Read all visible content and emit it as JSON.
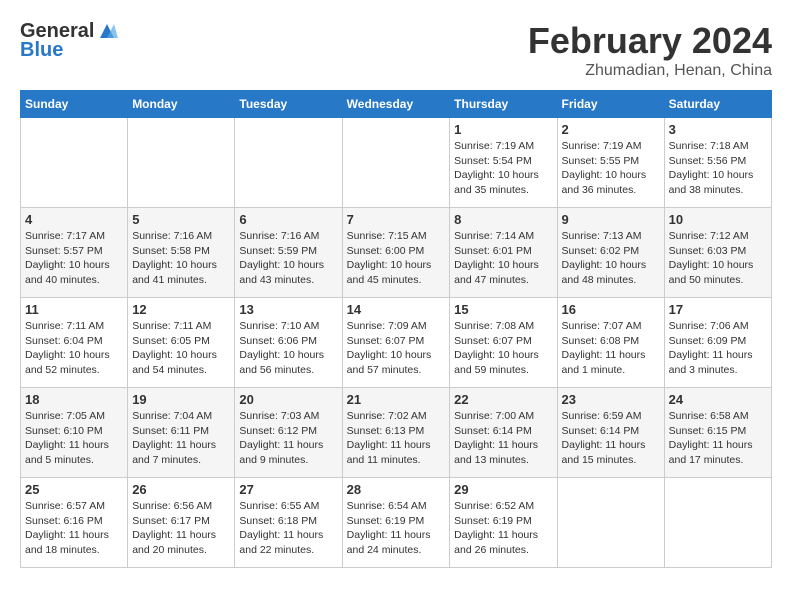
{
  "header": {
    "logo_general": "General",
    "logo_blue": "Blue",
    "month_title": "February 2024",
    "location": "Zhumadian, Henan, China"
  },
  "columns": [
    "Sunday",
    "Monday",
    "Tuesday",
    "Wednesday",
    "Thursday",
    "Friday",
    "Saturday"
  ],
  "weeks": [
    [
      {
        "day": "",
        "info": ""
      },
      {
        "day": "",
        "info": ""
      },
      {
        "day": "",
        "info": ""
      },
      {
        "day": "",
        "info": ""
      },
      {
        "day": "1",
        "info": "Sunrise: 7:19 AM\nSunset: 5:54 PM\nDaylight: 10 hours\nand 35 minutes."
      },
      {
        "day": "2",
        "info": "Sunrise: 7:19 AM\nSunset: 5:55 PM\nDaylight: 10 hours\nand 36 minutes."
      },
      {
        "day": "3",
        "info": "Sunrise: 7:18 AM\nSunset: 5:56 PM\nDaylight: 10 hours\nand 38 minutes."
      }
    ],
    [
      {
        "day": "4",
        "info": "Sunrise: 7:17 AM\nSunset: 5:57 PM\nDaylight: 10 hours\nand 40 minutes."
      },
      {
        "day": "5",
        "info": "Sunrise: 7:16 AM\nSunset: 5:58 PM\nDaylight: 10 hours\nand 41 minutes."
      },
      {
        "day": "6",
        "info": "Sunrise: 7:16 AM\nSunset: 5:59 PM\nDaylight: 10 hours\nand 43 minutes."
      },
      {
        "day": "7",
        "info": "Sunrise: 7:15 AM\nSunset: 6:00 PM\nDaylight: 10 hours\nand 45 minutes."
      },
      {
        "day": "8",
        "info": "Sunrise: 7:14 AM\nSunset: 6:01 PM\nDaylight: 10 hours\nand 47 minutes."
      },
      {
        "day": "9",
        "info": "Sunrise: 7:13 AM\nSunset: 6:02 PM\nDaylight: 10 hours\nand 48 minutes."
      },
      {
        "day": "10",
        "info": "Sunrise: 7:12 AM\nSunset: 6:03 PM\nDaylight: 10 hours\nand 50 minutes."
      }
    ],
    [
      {
        "day": "11",
        "info": "Sunrise: 7:11 AM\nSunset: 6:04 PM\nDaylight: 10 hours\nand 52 minutes."
      },
      {
        "day": "12",
        "info": "Sunrise: 7:11 AM\nSunset: 6:05 PM\nDaylight: 10 hours\nand 54 minutes."
      },
      {
        "day": "13",
        "info": "Sunrise: 7:10 AM\nSunset: 6:06 PM\nDaylight: 10 hours\nand 56 minutes."
      },
      {
        "day": "14",
        "info": "Sunrise: 7:09 AM\nSunset: 6:07 PM\nDaylight: 10 hours\nand 57 minutes."
      },
      {
        "day": "15",
        "info": "Sunrise: 7:08 AM\nSunset: 6:07 PM\nDaylight: 10 hours\nand 59 minutes."
      },
      {
        "day": "16",
        "info": "Sunrise: 7:07 AM\nSunset: 6:08 PM\nDaylight: 11 hours\nand 1 minute."
      },
      {
        "day": "17",
        "info": "Sunrise: 7:06 AM\nSunset: 6:09 PM\nDaylight: 11 hours\nand 3 minutes."
      }
    ],
    [
      {
        "day": "18",
        "info": "Sunrise: 7:05 AM\nSunset: 6:10 PM\nDaylight: 11 hours\nand 5 minutes."
      },
      {
        "day": "19",
        "info": "Sunrise: 7:04 AM\nSunset: 6:11 PM\nDaylight: 11 hours\nand 7 minutes."
      },
      {
        "day": "20",
        "info": "Sunrise: 7:03 AM\nSunset: 6:12 PM\nDaylight: 11 hours\nand 9 minutes."
      },
      {
        "day": "21",
        "info": "Sunrise: 7:02 AM\nSunset: 6:13 PM\nDaylight: 11 hours\nand 11 minutes."
      },
      {
        "day": "22",
        "info": "Sunrise: 7:00 AM\nSunset: 6:14 PM\nDaylight: 11 hours\nand 13 minutes."
      },
      {
        "day": "23",
        "info": "Sunrise: 6:59 AM\nSunset: 6:14 PM\nDaylight: 11 hours\nand 15 minutes."
      },
      {
        "day": "24",
        "info": "Sunrise: 6:58 AM\nSunset: 6:15 PM\nDaylight: 11 hours\nand 17 minutes."
      }
    ],
    [
      {
        "day": "25",
        "info": "Sunrise: 6:57 AM\nSunset: 6:16 PM\nDaylight: 11 hours\nand 18 minutes."
      },
      {
        "day": "26",
        "info": "Sunrise: 6:56 AM\nSunset: 6:17 PM\nDaylight: 11 hours\nand 20 minutes."
      },
      {
        "day": "27",
        "info": "Sunrise: 6:55 AM\nSunset: 6:18 PM\nDaylight: 11 hours\nand 22 minutes."
      },
      {
        "day": "28",
        "info": "Sunrise: 6:54 AM\nSunset: 6:19 PM\nDaylight: 11 hours\nand 24 minutes."
      },
      {
        "day": "29",
        "info": "Sunrise: 6:52 AM\nSunset: 6:19 PM\nDaylight: 11 hours\nand 26 minutes."
      },
      {
        "day": "",
        "info": ""
      },
      {
        "day": "",
        "info": ""
      }
    ]
  ]
}
